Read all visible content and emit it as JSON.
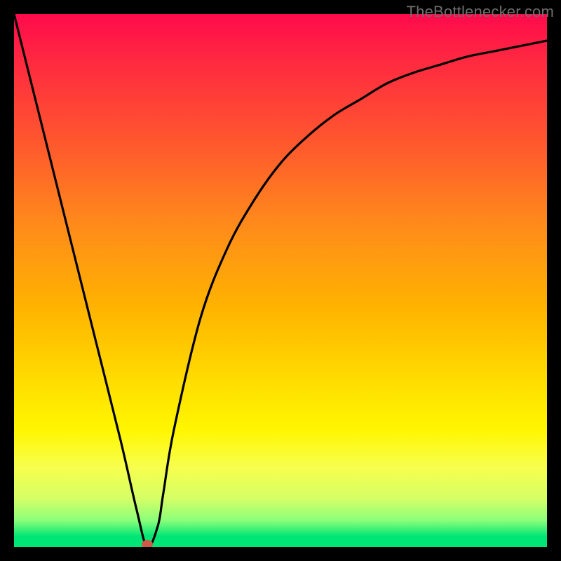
{
  "attribution": "TheBottlenecker.com",
  "chart_data": {
    "type": "line",
    "title": "",
    "xlabel": "",
    "ylabel": "",
    "xlim": [
      0,
      100
    ],
    "ylim": [
      0,
      100
    ],
    "series": [
      {
        "name": "bottleneck-curve",
        "x": [
          0,
          5,
          10,
          15,
          20,
          23,
          25,
          27,
          28,
          30,
          35,
          40,
          45,
          50,
          55,
          60,
          65,
          70,
          75,
          80,
          85,
          90,
          95,
          100
        ],
        "values": [
          100,
          80,
          60,
          40,
          20,
          7,
          0,
          4,
          10,
          22,
          43,
          56,
          65,
          72,
          77,
          81,
          84,
          87,
          89,
          90.5,
          92,
          93,
          94,
          95
        ]
      }
    ],
    "marker": {
      "x": 25,
      "y": 0,
      "color": "#d05a4a",
      "radius": 6
    },
    "background_gradient": {
      "stops": [
        {
          "pos": 0,
          "color": "#ff0a4c"
        },
        {
          "pos": 40,
          "color": "#ff8c1a"
        },
        {
          "pos": 70,
          "color": "#ffe000"
        },
        {
          "pos": 90,
          "color": "#d4ff66"
        },
        {
          "pos": 100,
          "color": "#00e676"
        }
      ]
    }
  }
}
